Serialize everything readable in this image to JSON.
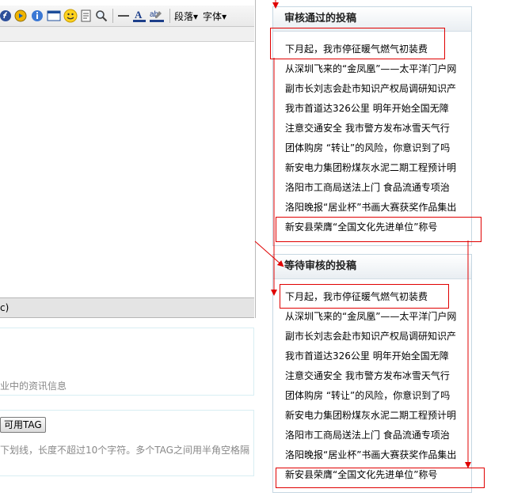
{
  "toolbar": {
    "paragraph_label": "段落",
    "font_label": "字体",
    "chevron": "▾",
    "abc_label": "ab"
  },
  "status_suffix": "c)",
  "resource_hint": "业中的资讯信息",
  "tag_button": "可用TAG",
  "tag_hint": "下划线，长度不超过10个字符。多个TAG之间用半角空格隔",
  "approved": {
    "title": "审核通过的投稿",
    "items": [
      "下月起，我市停征暖气燃气初装费",
      "从深圳飞来的“金凤凰”——太平洋门户网",
      "副市长刘志会赴市知识产权局调研知识产",
      "我市首道达326公里 明年开始全国无障",
      "注意交通安全 我市警方发布冰雪天气行",
      "团体购房 “转让”的风险，你意识到了吗",
      "新安电力集团粉煤灰水泥二期工程预计明",
      "洛阳市工商局送法上门 食品流通专项治",
      "洛阳晚报“居业杯”书画大赛获奖作品集出",
      "新安县荣膺“全国文化先进单位”称号"
    ]
  },
  "pending": {
    "title": "等待审核的投稿",
    "items": [
      "下月起，我市停征暖气燃气初装费",
      "从深圳飞来的“金凤凰”——太平洋门户网",
      "副市长刘志会赴市知识产权局调研知识产",
      "我市首道达326公里 明年开始全国无障",
      "注意交通安全 我市警方发布冰雪天气行",
      "团体购房 “转让”的风险，你意识到了吗",
      "新安电力集团粉煤灰水泥二期工程预计明",
      "洛阳市工商局送法上门 食品流通专项治",
      "洛阳晚报“居业杯”书画大赛获奖作品集出",
      "新安县荣膺“全国文化先进单位”称号"
    ]
  },
  "colors": {
    "annotation": "#e00000",
    "panel_border": "#c6d7e2"
  }
}
